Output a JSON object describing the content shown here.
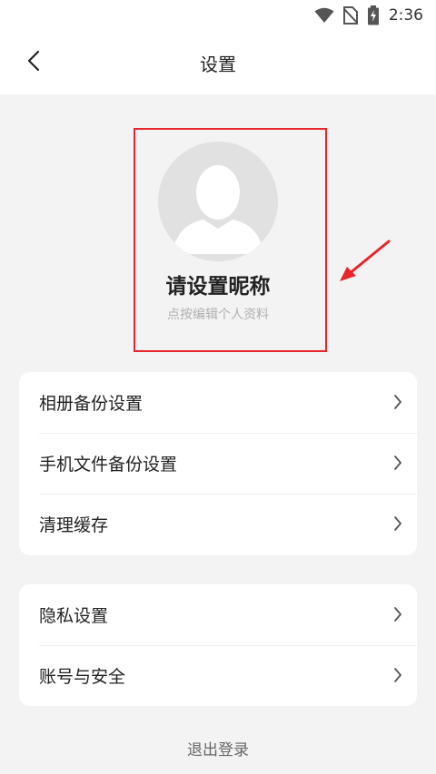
{
  "status_bar": {
    "time": "2:36",
    "icons": [
      "wifi-icon",
      "no-sim-icon",
      "battery-charging-icon"
    ]
  },
  "header": {
    "title": "设置",
    "back_icon": "chevron-left-icon"
  },
  "profile": {
    "nickname": "请设置昵称",
    "hint": "点按编辑个人资料",
    "avatar_icon": "default-avatar-icon"
  },
  "annotation": {
    "highlight_color": "#e8262a"
  },
  "settings_groups": [
    {
      "items": [
        {
          "label": "相册备份设置"
        },
        {
          "label": "手机文件备份设置"
        },
        {
          "label": "清理缓存"
        }
      ]
    },
    {
      "items": [
        {
          "label": "隐私设置"
        },
        {
          "label": "账号与安全"
        }
      ]
    }
  ],
  "logout_label": "退出登录"
}
